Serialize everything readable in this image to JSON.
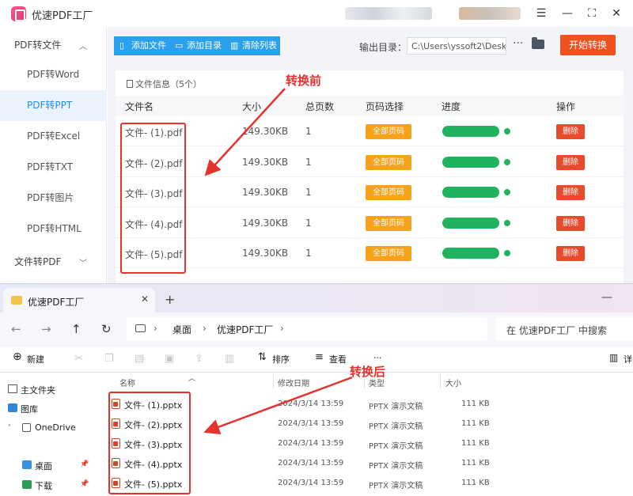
{
  "app": {
    "title": "优速PDF工厂",
    "sidebar": {
      "group1": "PDF转文件",
      "items": [
        "PDF转Word",
        "PDF转PPT",
        "PDF转Excel",
        "PDF转TXT",
        "PDF转图片",
        "PDF转HTML"
      ],
      "active_index": 1,
      "group2": "文件转PDF"
    },
    "toolbar": {
      "add_file": "添加文件",
      "add_dir": "添加目录",
      "clear_list": "清除列表",
      "output_label": "输出目录：",
      "output_path": "C:\\Users\\yssoft2\\Deskt",
      "start": "开始转换"
    },
    "file_info": "文件信息（5个）",
    "columns": [
      "文件名",
      "大小",
      "总页数",
      "页码选择",
      "进度",
      "操作"
    ],
    "rows": [
      {
        "name": "文件- (1).pdf",
        "size": "149.30KB",
        "pages": "1",
        "page_select": "全部页码",
        "progress": 1.0,
        "action": "删除"
      },
      {
        "name": "文件- (2).pdf",
        "size": "149.30KB",
        "pages": "1",
        "page_select": "全部页码",
        "progress": 1.0,
        "action": "删除"
      },
      {
        "name": "文件- (3).pdf",
        "size": "149.30KB",
        "pages": "1",
        "page_select": "全部页码",
        "progress": 1.0,
        "action": "删除"
      },
      {
        "name": "文件- (4).pdf",
        "size": "149.30KB",
        "pages": "1",
        "page_select": "全部页码",
        "progress": 1.0,
        "action": "删除"
      },
      {
        "name": "文件- (5).pdf",
        "size": "149.30KB",
        "pages": "1",
        "page_select": "全部页码",
        "progress": 1.0,
        "action": "删除"
      }
    ]
  },
  "annotations": {
    "before": "转换前",
    "after": "转换后",
    "color": "#e5322d"
  },
  "explorer": {
    "tab_title": "优速PDF工厂",
    "breadcrumb": [
      "桌面",
      "优速PDF工厂"
    ],
    "search_placeholder": "在 优速PDF工厂 中搜索",
    "toolbar": {
      "new": "新建",
      "sort": "排序",
      "view": "查看",
      "more": "···",
      "details": "详"
    },
    "nav": [
      "主文件夹",
      "图库",
      "OneDrive",
      "桌面",
      "下载"
    ],
    "columns": [
      "名称",
      "修改日期",
      "类型",
      "大小"
    ],
    "files": [
      {
        "name": "文件- (1).pptx",
        "date": "2024/3/14 13:59",
        "type": "PPTX 演示文稿",
        "size": "111 KB"
      },
      {
        "name": "文件- (2).pptx",
        "date": "2024/3/14 13:59",
        "type": "PPTX 演示文稿",
        "size": "111 KB"
      },
      {
        "name": "文件- (3).pptx",
        "date": "2024/3/14 13:59",
        "type": "PPTX 演示文稿",
        "size": "111 KB"
      },
      {
        "name": "文件- (4).pptx",
        "date": "2024/3/14 13:59",
        "type": "PPTX 演示文稿",
        "size": "111 KB"
      },
      {
        "name": "文件- (5).pptx",
        "date": "2024/3/14 13:59",
        "type": "PPTX 演示文稿",
        "size": "111 KB"
      }
    ]
  },
  "icons": [
    "app-logo-icon",
    "menu-icon",
    "minimize-icon",
    "maximize-icon",
    "close-icon",
    "chevron-up-icon",
    "chevron-down-icon",
    "file-icon",
    "folder-icon",
    "more-icon",
    "arrow-left-icon",
    "arrow-right-icon",
    "arrow-up-icon",
    "refresh-icon",
    "monitor-icon",
    "pptx-file-icon",
    "pin-icon"
  ]
}
